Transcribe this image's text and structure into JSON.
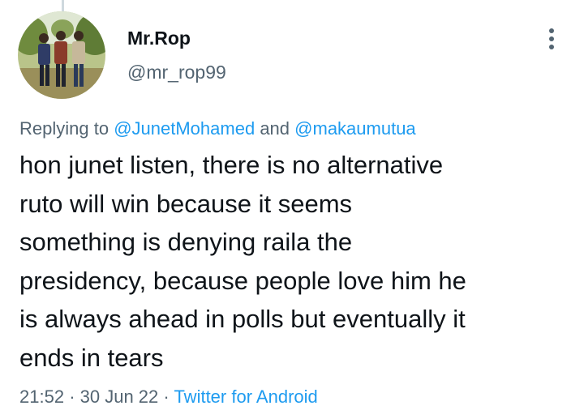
{
  "author": {
    "name": "Mr.Rop",
    "handle": "@mr_rop99"
  },
  "icons": {
    "more": "more-vertical-icon"
  },
  "reply_context": {
    "prefix": "Replying to",
    "mention_1": "@JunetMohamed",
    "conjunction": "and",
    "mention_2": "@makaumutua"
  },
  "tweet": {
    "lines": [
      "hon junet listen, there is no alternative",
      "ruto will win because it seems",
      "something is denying raila the",
      "presidency, because people love him he",
      "is always ahead in polls but eventually it",
      "ends in tears"
    ]
  },
  "meta": {
    "time": "21:52",
    "sep_1": "·",
    "date": "30 Jun 22",
    "sep_2": "·",
    "source": "Twitter for Android"
  },
  "colors": {
    "text": "#0f1419",
    "secondary": "#536471",
    "link": "#1d9bf0"
  }
}
